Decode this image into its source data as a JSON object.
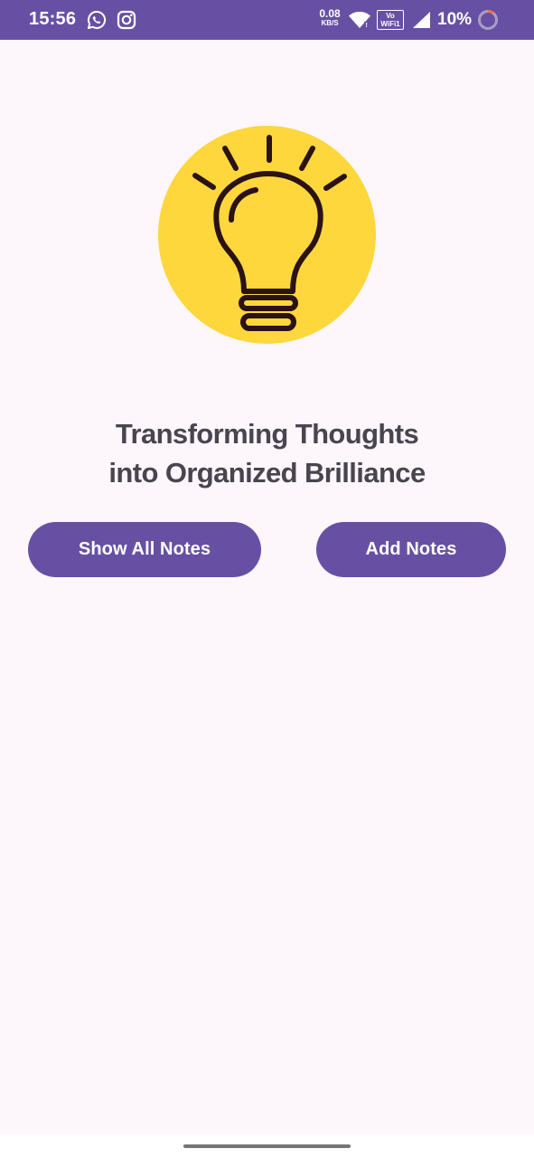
{
  "status_bar": {
    "time": "15:56",
    "net_speed_value": "0.08",
    "net_speed_unit": "KB/S",
    "vowifi_top": "Vo",
    "vowifi_bottom": "WiFi",
    "vowifi_sim": "1",
    "battery_percent": "10%",
    "icons": [
      "whatsapp-icon",
      "instagram-icon",
      "wifi-icon",
      "vowifi-icon",
      "cell-signal-icon",
      "battery-icon"
    ]
  },
  "hero": {
    "icon": "lightbulb-icon",
    "circle_color": "#fdd73c",
    "stroke_color": "#2a1216"
  },
  "tagline": {
    "line1": "Transforming Thoughts",
    "line2": "into Organized Brilliance"
  },
  "buttons": {
    "show_all_label": "Show All Notes",
    "add_label": "Add Notes"
  },
  "colors": {
    "primary": "#6750a4",
    "background": "#fdf7fc",
    "text": "#49454f"
  }
}
